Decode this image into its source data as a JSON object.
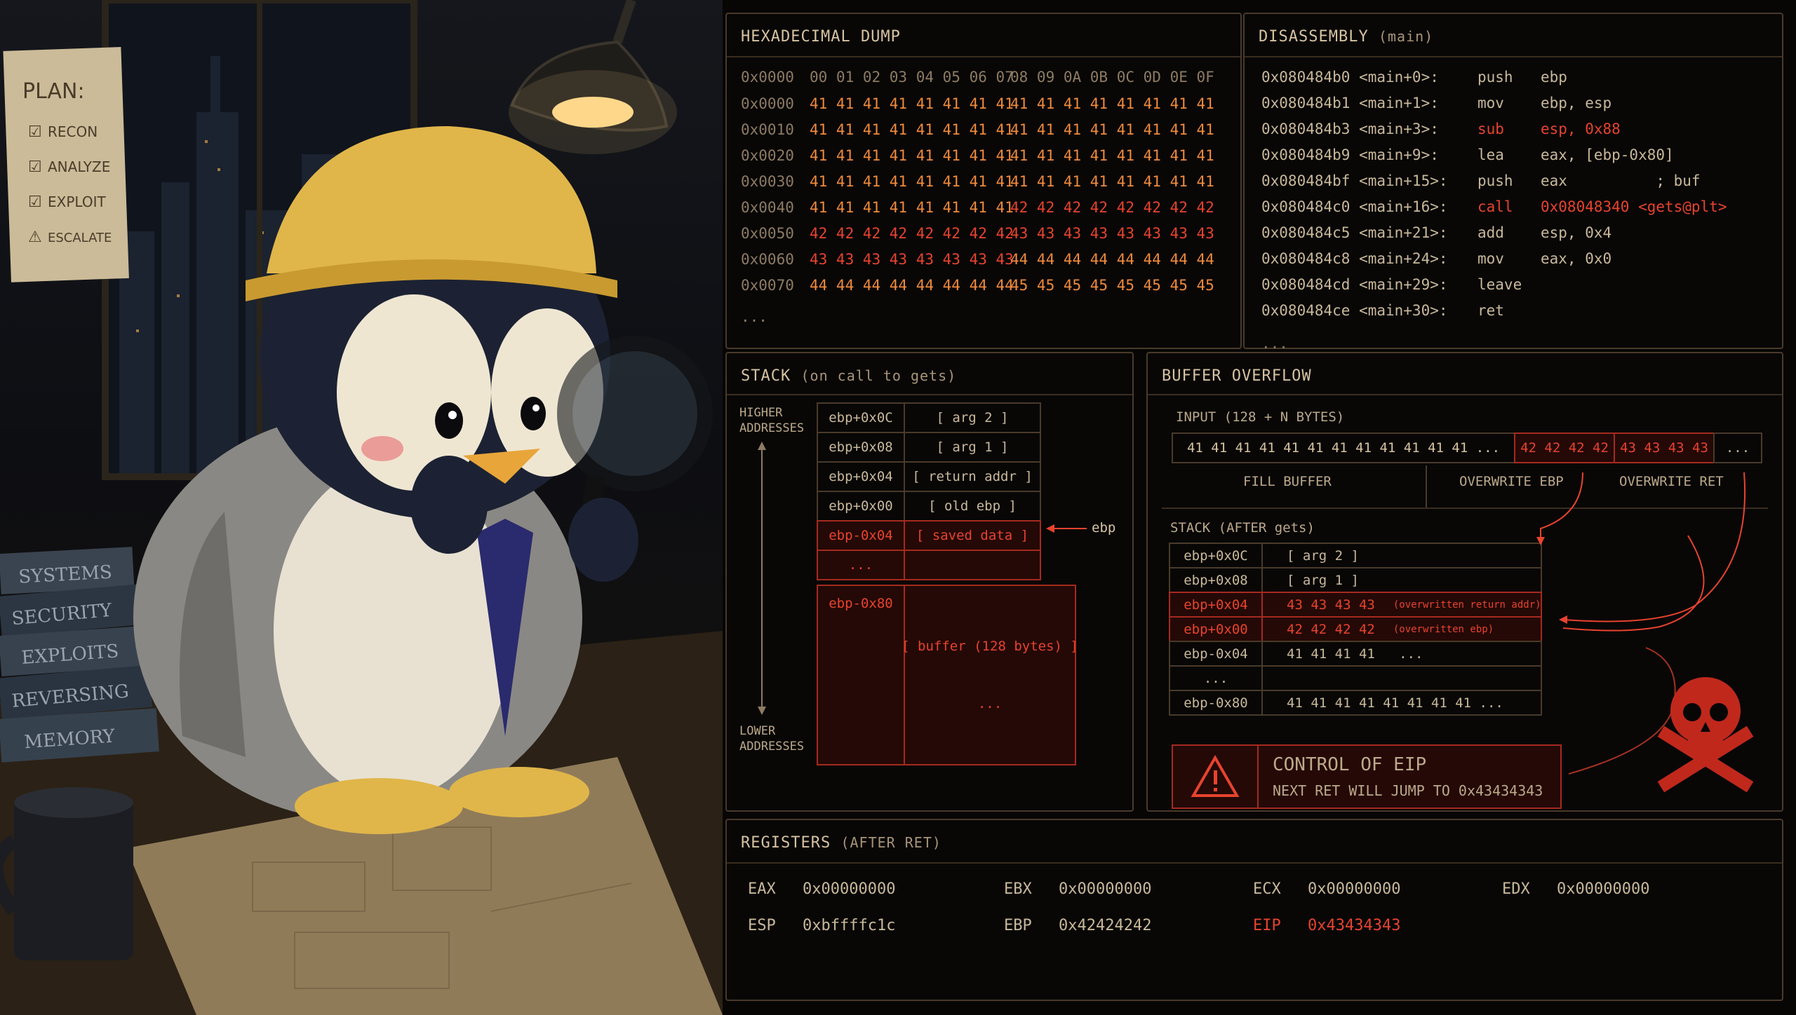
{
  "illustration": {
    "plan_title": "PLAN:",
    "plan_items": [
      "RECON",
      "ANALYZE",
      "EXPLOIT",
      "ESCALATE"
    ],
    "books": [
      "SYSTEMS",
      "SECURITY",
      "EXPLOITS",
      "REVERSING",
      "MEMORY"
    ]
  },
  "hexdump": {
    "title": "HEXADECIMAL DUMP",
    "header_offset": "0x0000",
    "header_cols_a": "00 01 02 03 04 05 06 07",
    "header_cols_b": "08 09 0A 0B 0C 0D 0E 0F",
    "rows": [
      {
        "off": "0x0000",
        "a": "41 41 41 41 41 41 41 41",
        "b": "41 41 41 41 41 41 41 41",
        "a_color": "org",
        "b_color": "org"
      },
      {
        "off": "0x0010",
        "a": "41 41 41 41 41 41 41 41",
        "b": "41 41 41 41 41 41 41 41",
        "a_color": "org",
        "b_color": "org"
      },
      {
        "off": "0x0020",
        "a": "41 41 41 41 41 41 41 41",
        "b": "41 41 41 41 41 41 41 41",
        "a_color": "org",
        "b_color": "org"
      },
      {
        "off": "0x0030",
        "a": "41 41 41 41 41 41 41 41",
        "b": "41 41 41 41 41 41 41 41",
        "a_color": "org",
        "b_color": "org"
      },
      {
        "off": "0x0040",
        "a": "41 41 41 41 41 41 41 41",
        "b": "42 42 42 42 42 42 42 42",
        "a_color": "org",
        "b_color": "red"
      },
      {
        "off": "0x0050",
        "a": "42 42 42 42 42 42 42 42",
        "b": "43 43 43 43 43 43 43 43",
        "a_color": "red",
        "b_color": "red"
      },
      {
        "off": "0x0060",
        "a": "43 43 43 43 43 43 43 43",
        "b": "44 44 44 44 44 44 44 44",
        "a_color": "red",
        "b_color": "org"
      },
      {
        "off": "0x0070",
        "a": "44 44 44 44 44 44 44 44",
        "b": "45 45 45 45 45 45 45 45",
        "a_color": "org",
        "b_color": "org"
      }
    ],
    "ellipsis": "..."
  },
  "disasm": {
    "title": "DISASSEMBLY",
    "subtitle": "(main)",
    "rows": [
      {
        "addr": "0x080484b0 <main+0>:",
        "op": "push",
        "arg": "ebp",
        "red": false
      },
      {
        "addr": "0x080484b1 <main+1>:",
        "op": "mov",
        "arg": "ebp, esp",
        "red": false
      },
      {
        "addr": "0x080484b3 <main+3>:",
        "op": "sub",
        "arg": "esp, 0x88",
        "red": true
      },
      {
        "addr": "0x080484b9 <main+9>:",
        "op": "lea",
        "arg": "eax, [ebp-0x80]",
        "red": false
      },
      {
        "addr": "0x080484bf <main+15>:",
        "op": "push",
        "arg": "eax          ; buf",
        "red": false
      },
      {
        "addr": "0x080484c0 <main+16>:",
        "op": "call",
        "arg": "0x08048340 <gets@plt>",
        "red": true
      },
      {
        "addr": "0x080484c5 <main+21>:",
        "op": "add",
        "arg": "esp, 0x4",
        "red": false
      },
      {
        "addr": "0x080484c8 <main+24>:",
        "op": "mov",
        "arg": "eax, 0x0",
        "red": false
      },
      {
        "addr": "0x080484cd <main+29>:",
        "op": "leave",
        "arg": "",
        "red": false
      },
      {
        "addr": "0x080484ce <main+30>:",
        "op": "ret",
        "arg": "",
        "red": false
      }
    ],
    "ellipsis": "..."
  },
  "stack": {
    "title": "STACK",
    "subtitle": "(on call to gets)",
    "higher": "HIGHER\nADDRESSES",
    "lower": "LOWER\nADDRESSES",
    "rows": [
      {
        "off": "ebp+0x0C",
        "val": "[ arg 2 ]"
      },
      {
        "off": "ebp+0x08",
        "val": "[ arg 1 ]"
      },
      {
        "off": "ebp+0x04",
        "val": "[ return addr ]"
      },
      {
        "off": "ebp+0x00",
        "val": "[ old ebp ]"
      },
      {
        "off": "ebp-0x04",
        "val": "[ saved data ]"
      },
      {
        "off": "...",
        "val": ""
      }
    ],
    "buffer_off": "ebp-0x80",
    "buffer_label": "[ buffer (128 bytes) ]",
    "buffer_dots": "...",
    "ebp_pointer": "ebp"
  },
  "overflow": {
    "title": "BUFFER OVERFLOW",
    "input_label": "INPUT (128 + N BYTES)",
    "input_fill": "41 41 41 41 41 41 41 41 41 41 41 41 ...",
    "input_ebp": "42 42 42 42",
    "input_ret": "43 43 43 43",
    "input_more": "...",
    "seg_fill": "FILL BUFFER",
    "seg_ebp": "OVERWRITE EBP",
    "seg_ret": "OVERWRITE RET",
    "after_label": "STACK (AFTER gets)",
    "after_rows": [
      {
        "off": "ebp+0x0C",
        "val": "[ arg 2 ]",
        "note": "",
        "red": false
      },
      {
        "off": "ebp+0x08",
        "val": "[ arg 1 ]",
        "note": "",
        "red": false
      },
      {
        "off": "ebp+0x04",
        "val": "43 43 43 43",
        "note": "(overwritten return addr)",
        "red": true
      },
      {
        "off": "ebp+0x00",
        "val": "42 42 42 42",
        "note": "(overwritten ebp)",
        "red": true
      },
      {
        "off": "ebp-0x04",
        "val": "41 41 41 41   ...",
        "note": "",
        "red": false
      },
      {
        "off": "...",
        "val": "",
        "note": "",
        "red": false
      },
      {
        "off": "ebp-0x80",
        "val": "41 41 41 41 41 41 41 41 ...",
        "note": "",
        "red": false
      }
    ],
    "alert_title": "CONTROL OF EIP",
    "alert_text": "NEXT RET WILL JUMP TO 0x43434343"
  },
  "registers": {
    "title": "REGISTERS",
    "subtitle": "(AFTER RET)",
    "items": [
      {
        "name": "EAX",
        "value": "0x00000000",
        "red": false
      },
      {
        "name": "EBX",
        "value": "0x00000000",
        "red": false
      },
      {
        "name": "ECX",
        "value": "0x00000000",
        "red": false
      },
      {
        "name": "EDX",
        "value": "0x00000000",
        "red": false
      },
      {
        "name": "ESP",
        "value": "0xbffffc1c",
        "red": false
      },
      {
        "name": "EBP",
        "value": "0x42424242",
        "red": false
      },
      {
        "name": "EIP",
        "value": "0x43434343",
        "red": true
      }
    ]
  },
  "colors": {
    "accent_red": "#e8432e",
    "accent_orange": "#f08a3c",
    "border": "#4a3a2a",
    "hardhat": "#e0b64a"
  }
}
